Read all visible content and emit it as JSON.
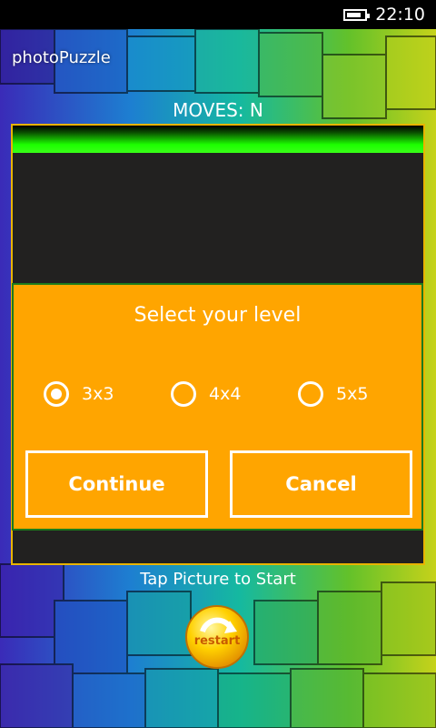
{
  "status_bar": {
    "time": "22:10",
    "battery_level": 0.85
  },
  "app": {
    "title": "photoPuzzle"
  },
  "moves": {
    "label": "MOVES: N"
  },
  "dialog": {
    "title": "Select your level",
    "options": [
      {
        "label": "3x3",
        "selected": true
      },
      {
        "label": "4x4",
        "selected": false
      },
      {
        "label": "5x5",
        "selected": false
      }
    ],
    "continue_label": "Continue",
    "cancel_label": "Cancel"
  },
  "hint": "Tap Picture to Start",
  "restart_button": {
    "label": "restart"
  },
  "colors": {
    "dialog_bg": "#ffa500",
    "board_bg": "#222120",
    "board_border": "#e8b400",
    "progress_green": "#1cff00"
  }
}
